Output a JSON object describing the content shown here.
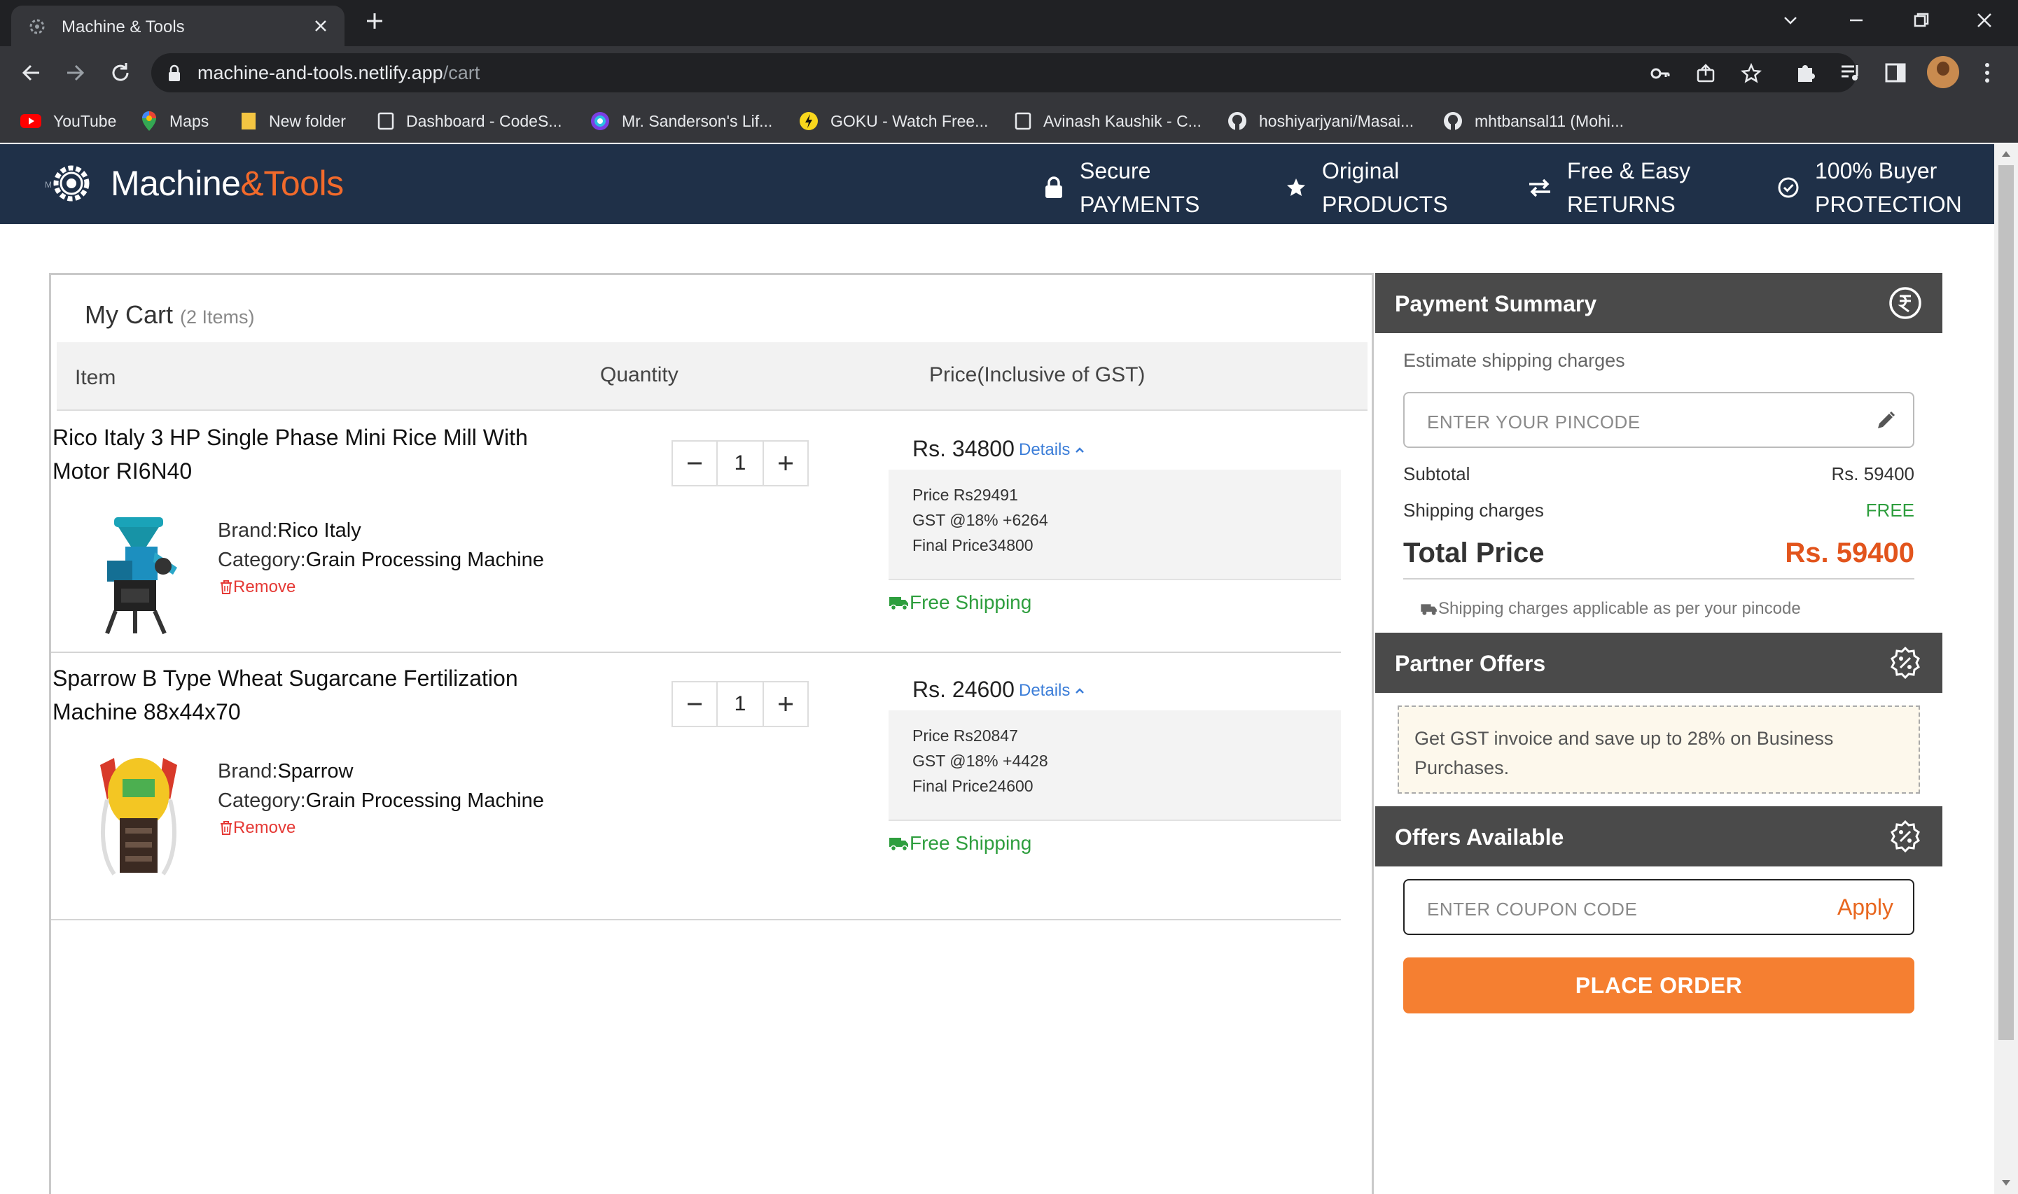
{
  "browser": {
    "tab_title": "Machine & Tools",
    "url_host": "machine-and-tools.netlify.app",
    "url_path": "/cart",
    "bookmarks": [
      {
        "label": "YouTube",
        "icon": "youtube-icon"
      },
      {
        "label": "Maps",
        "icon": "maps-icon"
      },
      {
        "label": "New folder",
        "icon": "folder-icon"
      },
      {
        "label": "Dashboard - CodeS...",
        "icon": "page-icon"
      },
      {
        "label": "Mr. Sanderson's Lif...",
        "icon": "site-icon"
      },
      {
        "label": "GOKU - Watch Free...",
        "icon": "site-icon"
      },
      {
        "label": "Avinash Kaushik - C...",
        "icon": "page-icon"
      },
      {
        "label": "hoshiyarjyani/Masai...",
        "icon": "github-icon"
      },
      {
        "label": "mhtbansal11 (Mohi...",
        "icon": "github-icon"
      }
    ]
  },
  "header": {
    "brand_part1": "Machine",
    "brand_amp": "&",
    "brand_part2": "Tools",
    "features": [
      {
        "line1": "Secure",
        "line2": "PAYMENTS",
        "icon": "lock-icon"
      },
      {
        "line1": "Original",
        "line2": "PRODUCTS",
        "icon": "star-icon"
      },
      {
        "line1": "Free & Easy",
        "line2": "RETURNS",
        "icon": "exchange-icon"
      },
      {
        "line1": "100% Buyer",
        "line2": "PROTECTION",
        "icon": "check-circle-icon"
      }
    ]
  },
  "cart": {
    "title": "My Cart",
    "count_label": "(2 Items)",
    "columns": {
      "item": "Item",
      "quantity": "Quantity",
      "price": "Price(Inclusive of GST)"
    },
    "brand_label": "Brand:",
    "category_label": "Category:",
    "remove_label": "Remove",
    "details_label": "Details",
    "shipping_label": "Free Shipping",
    "items": [
      {
        "name": "Rico Italy 3 HP Single Phase Mini Rice Mill With Motor RI6N40",
        "brand": "Rico Italy",
        "category": "Grain Processing Machine",
        "quantity": "1",
        "price": "Rs. 34800",
        "base_price": "Price Rs29491",
        "gst": "GST @18% +6264",
        "final_price": "Final Price34800"
      },
      {
        "name": "Sparrow B Type Wheat Sugarcane Fertilization Machine 88x44x70",
        "brand": "Sparrow",
        "category": "Grain Processing Machine",
        "quantity": "1",
        "price": "Rs. 24600",
        "base_price": "Price Rs20847",
        "gst": "GST @18% +4428",
        "final_price": "Final Price24600"
      }
    ]
  },
  "summary": {
    "title": "Payment Summary",
    "estimate_label": "Estimate shipping charges",
    "pincode_placeholder": "ENTER YOUR PINCODE",
    "subtotal_label": "Subtotal",
    "subtotal_value": "Rs. 59400",
    "shipping_label": "Shipping charges",
    "shipping_value": "FREE",
    "total_label": "Total Price",
    "total_value": "Rs. 59400",
    "note": "Shipping charges applicable as per your pincode"
  },
  "partner": {
    "title": "Partner Offers",
    "text": "Get GST invoice and save up to 28% on Business Purchases."
  },
  "offers": {
    "title": "Offers Available",
    "coupon_placeholder": "ENTER COUPON CODE",
    "apply_label": "Apply",
    "place_order_label": "PLACE ORDER"
  },
  "colors": {
    "header_bg": "#1f3048",
    "accent": "#f26a2b",
    "section_head": "#4a4a4a",
    "free_green": "#2e9e3e",
    "remove_red": "#e53935",
    "link_blue": "#3b7dd8"
  }
}
